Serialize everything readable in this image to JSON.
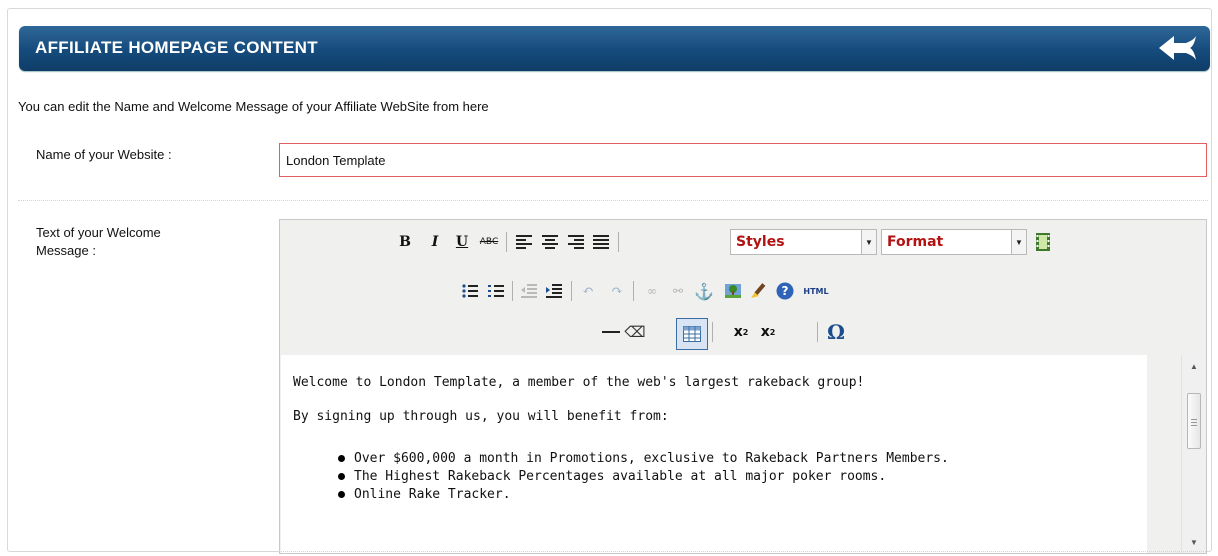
{
  "header": {
    "title": "AFFILIATE HOMEPAGE CONTENT",
    "icon": "back-arrow-icon",
    "colors": {
      "top": "#2f6799",
      "bottom": "#0f3d67"
    }
  },
  "intro": "You can edit the Name and Welcome Message of your Affiliate WebSite from here",
  "name_row": {
    "label": "Name of your Website :",
    "value": "London Template"
  },
  "welcome_row": {
    "label_line1": "Text of your Welcome",
    "label_line2": "Message :"
  },
  "toolbar": {
    "bold": "B",
    "italic": "I",
    "underline": "U",
    "strike": "ABC",
    "styles_label": "Styles",
    "format_label": "Format",
    "html_label": "HTML",
    "subscript": "x",
    "superscript": "x",
    "omega": "Ω",
    "accent_color": "#b31212"
  },
  "content": {
    "p1": "Welcome to London Template, a member of the web's largest rakeback group!",
    "p2": "By signing up through us, you will benefit from:",
    "bullets": [
      "Over $600,000 a month in Promotions, exclusive to Rakeback Partners Members.",
      "The Highest Rakeback Percentages available at all major poker rooms.",
      "Online Rake Tracker."
    ]
  }
}
